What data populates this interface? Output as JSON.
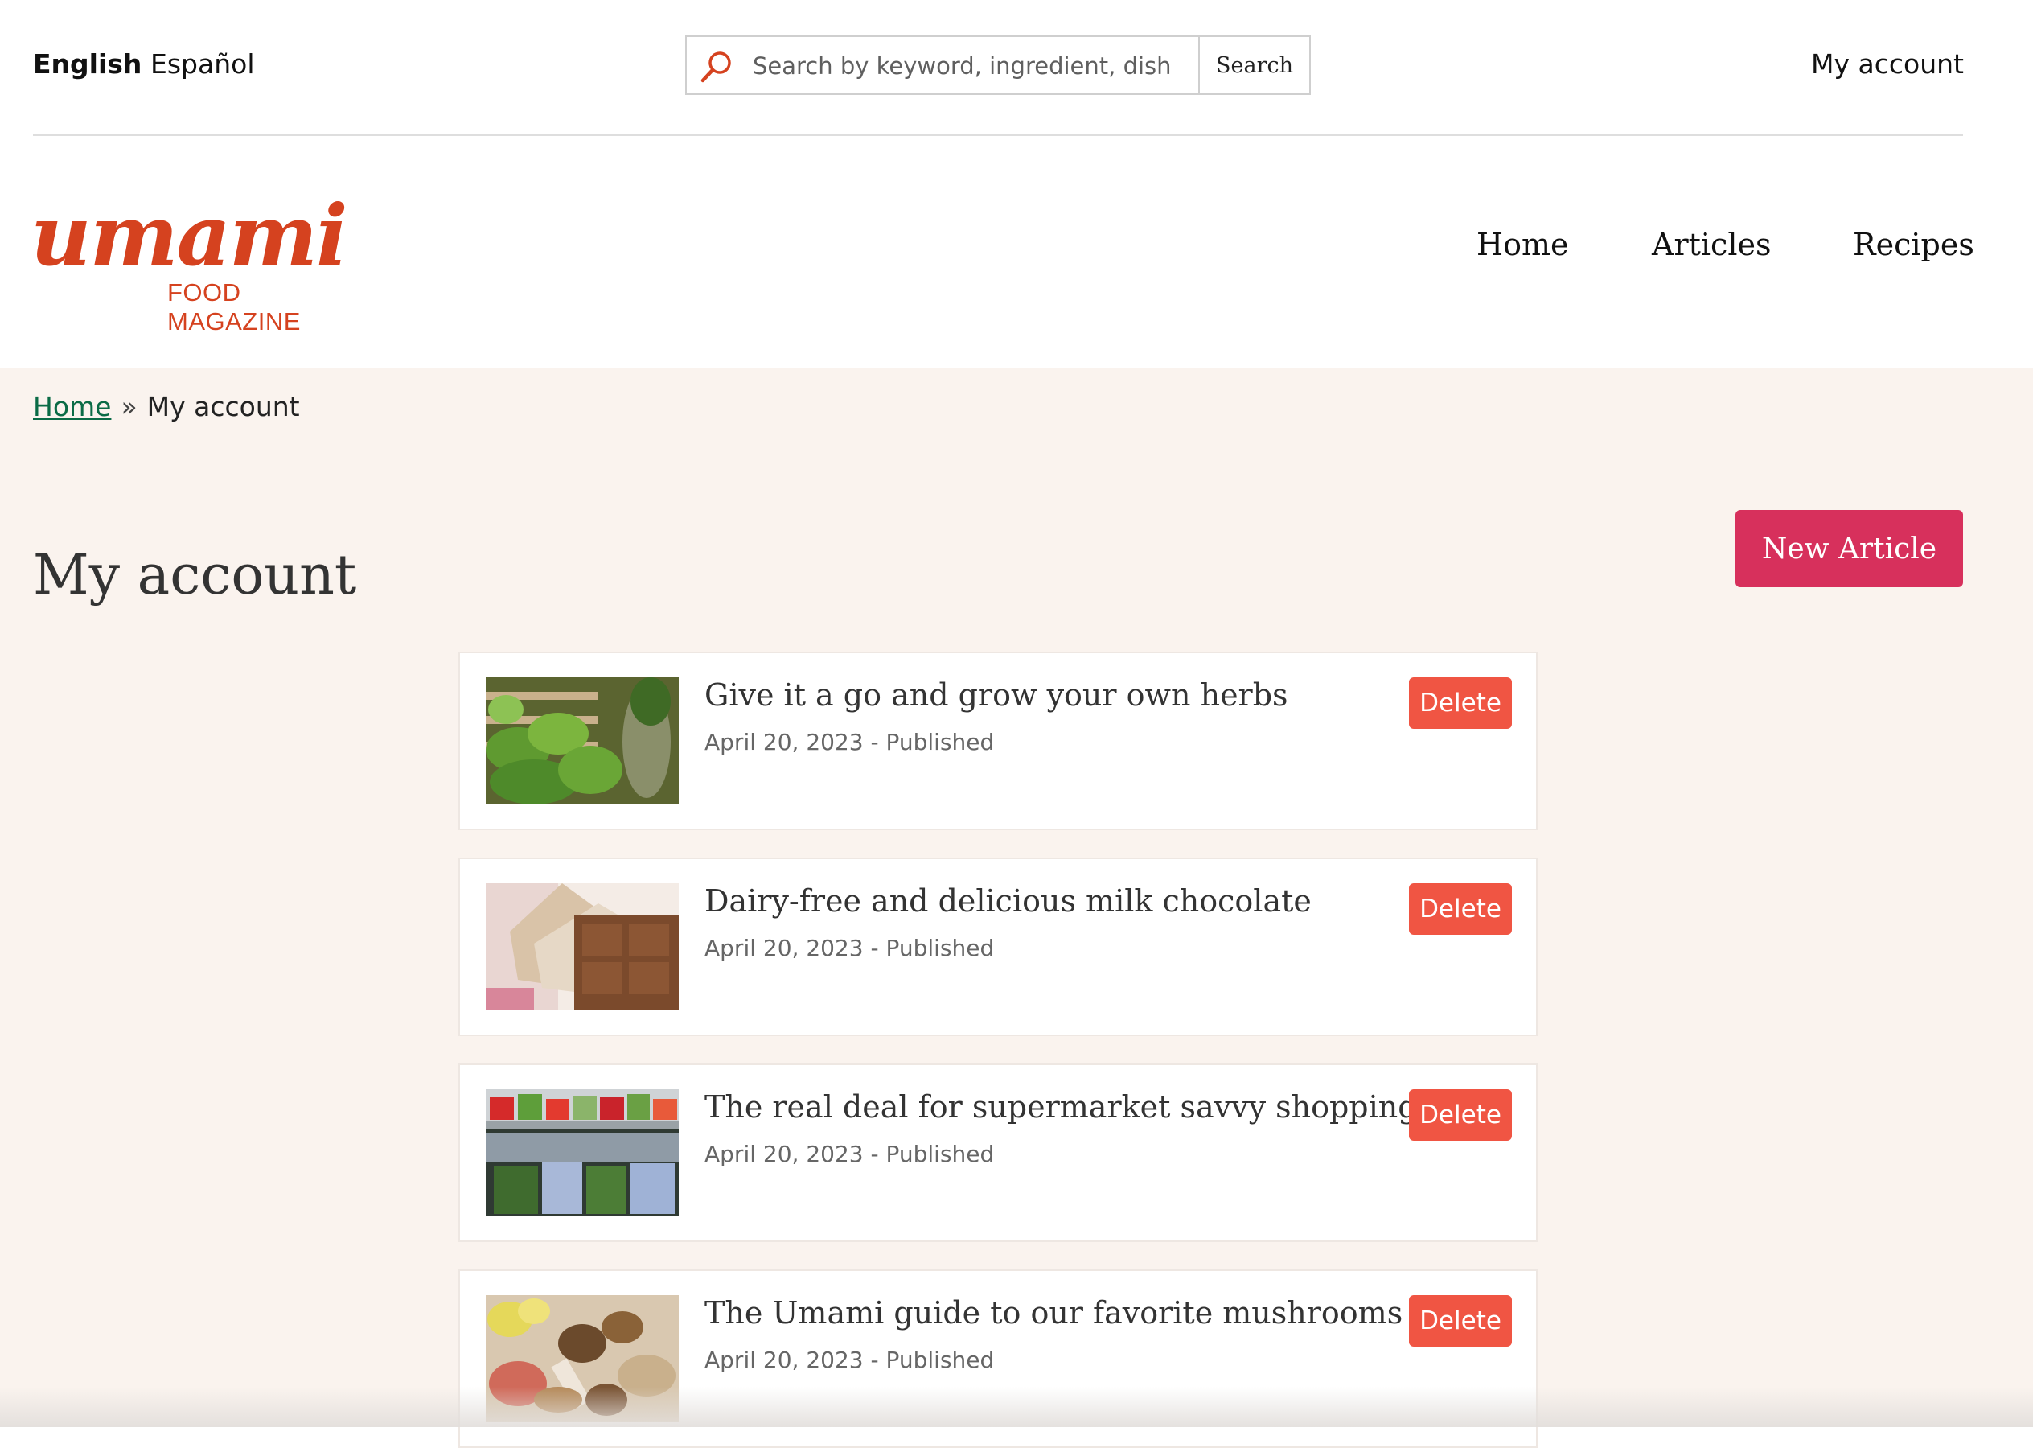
{
  "header": {
    "languages": [
      "English",
      "Español"
    ],
    "search": {
      "placeholder": "Search by keyword, ingredient, dish",
      "button": "Search"
    },
    "account_link": "My account",
    "logo": {
      "word": "umami",
      "subtitle": "FOOD MAGAZINE"
    },
    "nav": [
      "Home",
      "Articles",
      "Recipes"
    ]
  },
  "breadcrumb": {
    "home": "Home",
    "separator": "»",
    "current": "My account"
  },
  "page": {
    "title": "My account",
    "new_article_label": "New Article"
  },
  "articles": [
    {
      "title": "Give it a go and grow your own herbs",
      "meta": "April 20, 2023 - Published",
      "delete_label": "Delete",
      "image": "herbs-photo"
    },
    {
      "title": "Dairy-free and delicious milk chocolate",
      "meta": "April 20, 2023 - Published",
      "delete_label": "Delete",
      "image": "chocolate-photo"
    },
    {
      "title": "The real deal for supermarket savvy shopping",
      "meta": "April 20, 2023 - Published",
      "delete_label": "Delete",
      "image": "supermarket-photo"
    },
    {
      "title": "The Umami guide to our favorite mushrooms",
      "meta": "April 20, 2023 - Published",
      "delete_label": "Delete",
      "image": "mushrooms-photo"
    }
  ],
  "colors": {
    "brand": "#d5421f",
    "primary_button": "#d7305c",
    "delete_button": "#f05543",
    "link": "#0a6b46",
    "content_bg": "#faf3ee"
  }
}
